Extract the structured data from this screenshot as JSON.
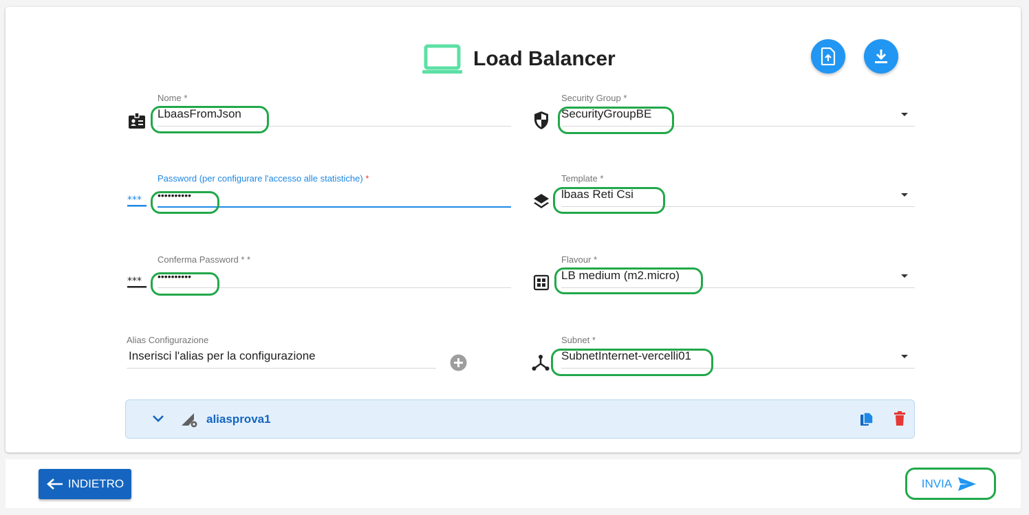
{
  "header": {
    "title": "Load Balancer",
    "upload_icon": "file-upload-icon",
    "download_icon": "download-icon",
    "accent_color": "#2196f3",
    "title_icon_color": "#5ce0a4"
  },
  "form": {
    "nome": {
      "label": "Nome",
      "required_mark": "*",
      "value": "LbaasFromJson",
      "icon": "badge-icon"
    },
    "password": {
      "label": "Password (per configurare l'accesso alle statistiche)",
      "required_mark": "*",
      "value": "••••••••••",
      "icon": "password-icon"
    },
    "conferma_password": {
      "label": "Conferma Password * *",
      "value": "••••••••••",
      "icon": "password-icon"
    },
    "alias": {
      "label": "Alias Configurazione",
      "placeholder": "Inserisci l'alias per la configurazione",
      "add_icon": "add-circle-icon"
    },
    "security_group": {
      "label": "Security Group",
      "required_mark": "*",
      "value": "SecurityGroupBE",
      "icon": "shield-icon"
    },
    "template": {
      "label": "Template",
      "required_mark": "*",
      "value": "lbaas Reti Csi",
      "icon": "layers-icon"
    },
    "flavour": {
      "label": "Flavour",
      "required_mark": "*",
      "value": "LB medium (m2.micro)",
      "icon": "chip-icon"
    },
    "subnet": {
      "label": "Subnet",
      "required_mark": "*",
      "value": "SubnetInternet-vercelli01",
      "icon": "network-icon"
    }
  },
  "alias_list": [
    {
      "name": "aliasprova1",
      "expand_icon": "chevron-down-icon",
      "settings_icon": "signal-settings-icon",
      "copy_icon": "copy-icon",
      "delete_icon": "delete-icon"
    }
  ],
  "footer": {
    "back_label": "INDIETRO",
    "send_label": "INVIA"
  },
  "colors": {
    "highlight": "#21a84a",
    "delete": "#e53935",
    "primary_dark": "#1565c0"
  }
}
